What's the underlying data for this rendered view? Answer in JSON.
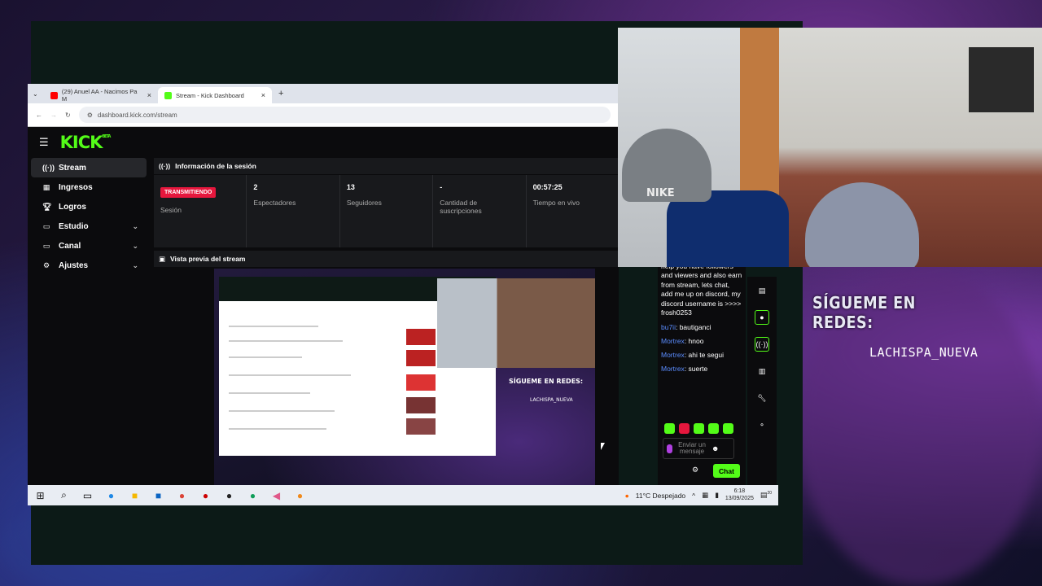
{
  "browser": {
    "tabs": [
      {
        "label": "(29) Anuel AA - Nacimos Pa M",
        "icon": "youtube-icon"
      },
      {
        "label": "Stream - Kick Dashboard",
        "icon": "kick-icon"
      }
    ],
    "address": "dashboard.kick.com/stream"
  },
  "kick": {
    "logo": "KICK",
    "logo_badge": "BETA",
    "sidebar": [
      {
        "label": "Stream",
        "icon": "stream-icon",
        "active": true
      },
      {
        "label": "Ingresos",
        "icon": "income-icon"
      },
      {
        "label": "Logros",
        "icon": "trophy-icon"
      },
      {
        "label": "Estudio",
        "icon": "studio-icon",
        "expand": true
      },
      {
        "label": "Canal",
        "icon": "channel-icon",
        "expand": true
      },
      {
        "label": "Ajustes",
        "icon": "settings-icon",
        "expand": true
      }
    ],
    "session": {
      "title": "Información de la sesión",
      "stats": [
        {
          "value": "TRANSMITIENDO",
          "label": "Sesión",
          "badge": true
        },
        {
          "value": "2",
          "label": "Espectadores"
        },
        {
          "value": "13",
          "label": "Seguidores"
        },
        {
          "value": "-",
          "label": "Cantidad de suscripciones"
        },
        {
          "value": "00:57:25",
          "label": "Tiempo en vivo"
        }
      ]
    },
    "preview_title": "Vista previa del stream",
    "preview": {
      "sigueme": "SÍGUEME EN REDES:",
      "handle": "LACHISPA_NUEVA"
    }
  },
  "chat": {
    "partial": "help you have followers and viewers and also earn from stream, lets chat, add me up on discord, my discord username is >>>> frosh0253",
    "messages": [
      {
        "user": "bu7ii",
        "text": "bautiganci"
      },
      {
        "user": "Mortrex",
        "text": "hnoo"
      },
      {
        "user": "Mortrex",
        "text": "ahi te segui"
      },
      {
        "user": "Mortrex",
        "text": "suerte"
      }
    ],
    "placeholder": "Enviar un mensaje",
    "send": "Chat"
  },
  "taskbar": {
    "weather": "11°C Despejado",
    "time": "6:18",
    "date": "13/09/2025",
    "notif_count": "20"
  },
  "overlay": {
    "sigueme": "SÍGUEME EN REDES:",
    "handle": "LACHISPA_NUEVA"
  },
  "webcam": {
    "cap_text": "NIKE"
  },
  "colors": {
    "kick_green": "#53fc18",
    "live_red": "#e6173d"
  }
}
